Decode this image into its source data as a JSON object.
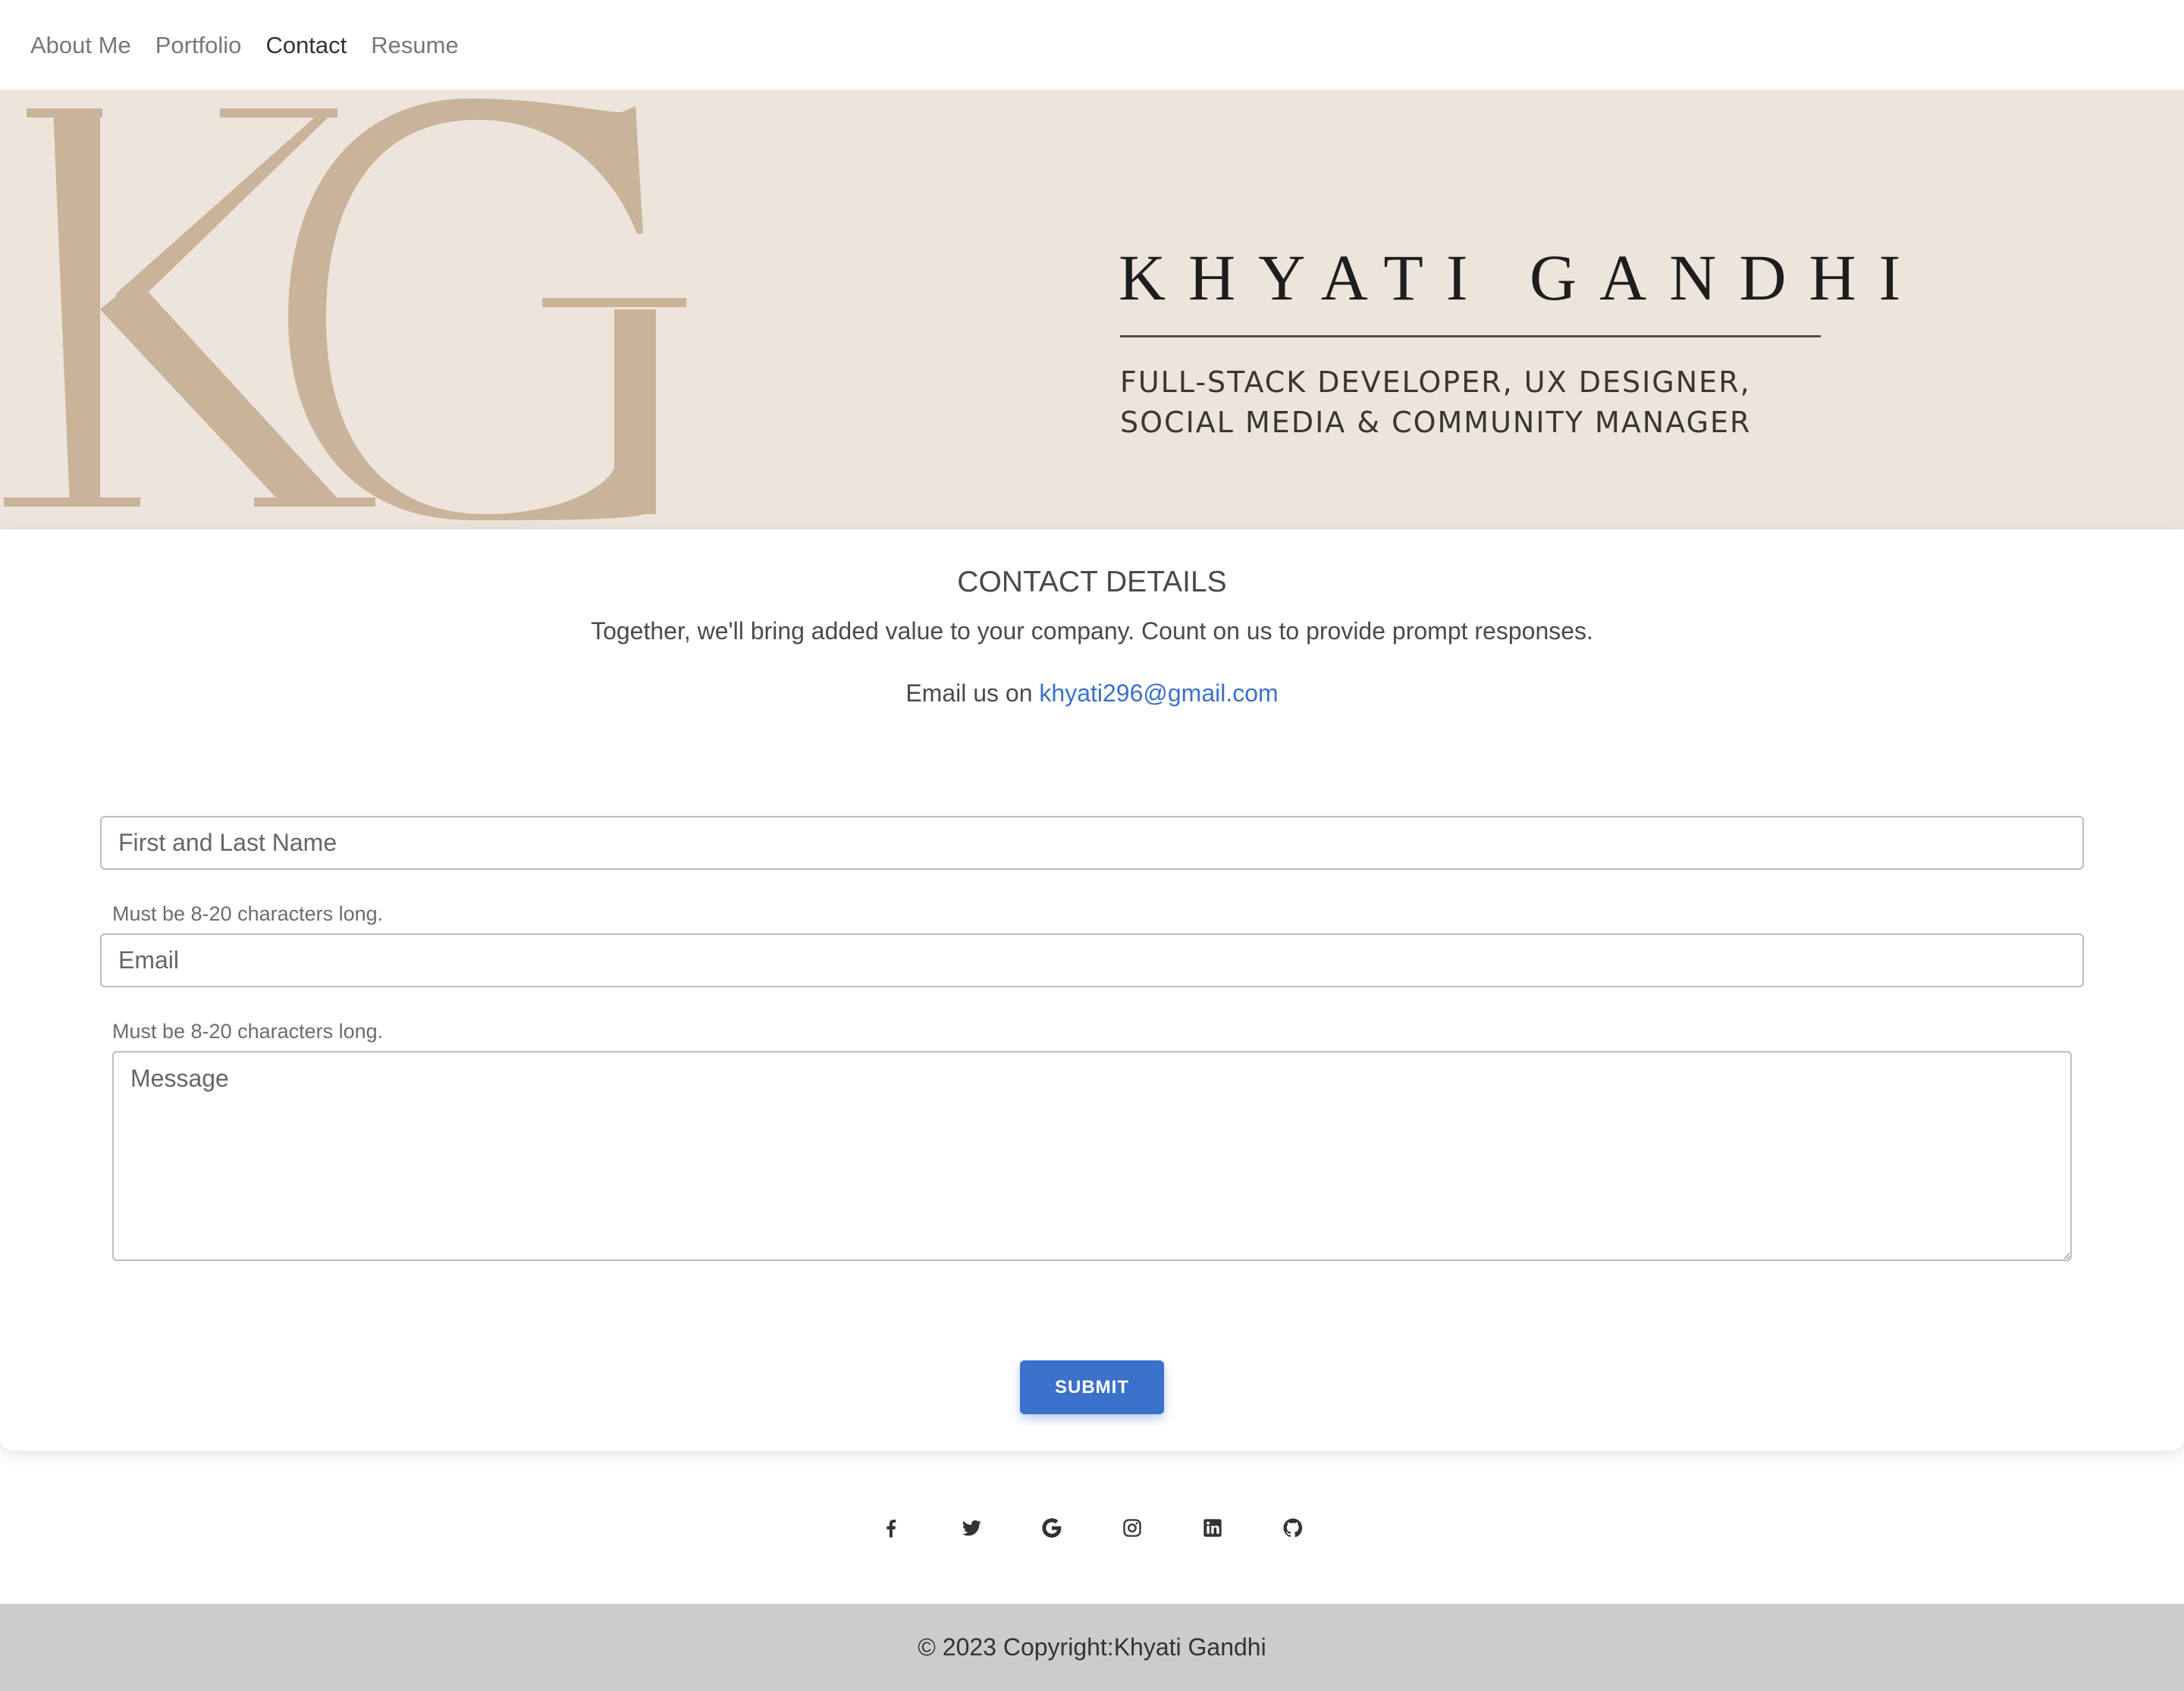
{
  "nav": {
    "items": [
      {
        "label": "About Me",
        "active": false
      },
      {
        "label": "Portfolio",
        "active": false
      },
      {
        "label": "Contact",
        "active": true
      },
      {
        "label": "Resume",
        "active": false
      }
    ]
  },
  "hero": {
    "monogram": "KG",
    "name": "KHYATI GANDHI",
    "tagline_line1": "FULL-STACK DEVELOPER, UX DESIGNER,",
    "tagline_line2": "SOCIAL MEDIA & COMMUNITY MANAGER",
    "background_color": "#ede4dc",
    "monogram_color": "#c9b39a"
  },
  "contact": {
    "title": "CONTACT DETAILS",
    "description": "Together, we'll bring added value to your company. Count on us to provide prompt responses.",
    "email_prefix": "Email us on ",
    "email": "khyati296@gmail.com"
  },
  "form": {
    "name_placeholder": "First and Last Name",
    "name_hint": "Must be 8-20 characters long.",
    "email_placeholder": "Email",
    "email_hint": "Must be 8-20 characters long.",
    "message_placeholder": "Message",
    "submit_label": "SUBMIT",
    "accent_color": "#3b71ca"
  },
  "social": {
    "icons": [
      "facebook-icon",
      "twitter-icon",
      "google-icon",
      "instagram-icon",
      "linkedin-icon",
      "github-icon"
    ]
  },
  "footer": {
    "copyright": "© 2023 Copyright:Khyati Gandhi"
  }
}
